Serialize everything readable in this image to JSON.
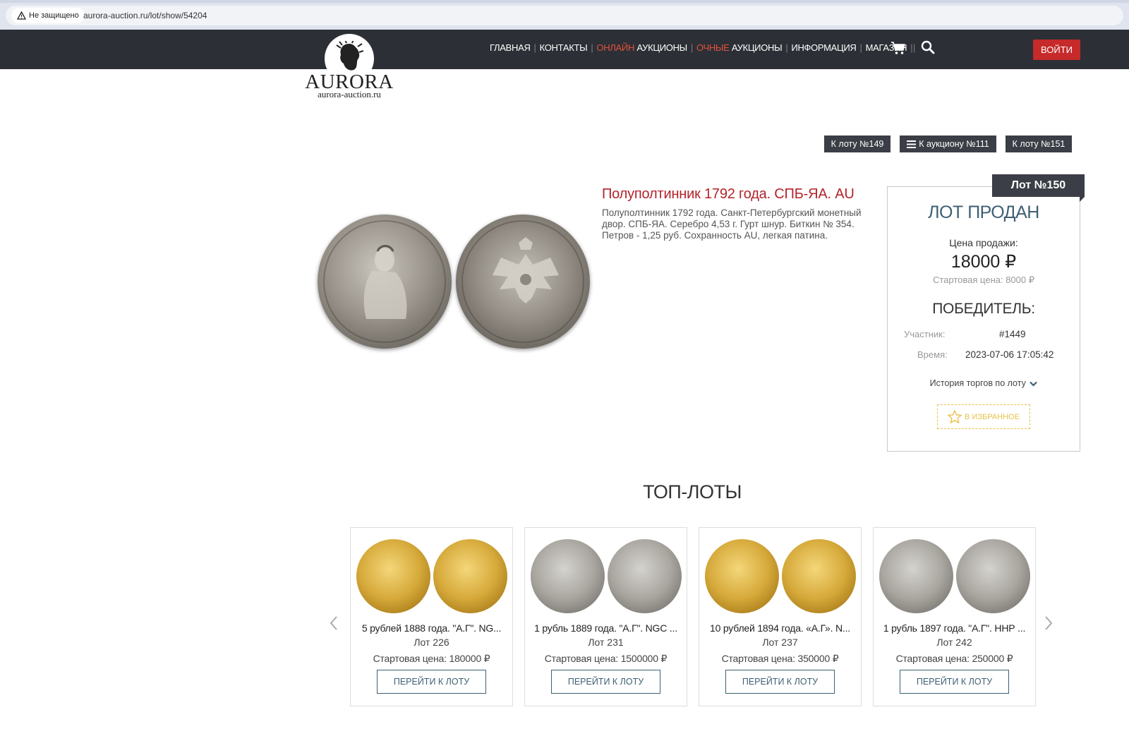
{
  "browser": {
    "security_label": "Не защищено",
    "url": "aurora-auction.ru/lot/show/54204"
  },
  "header": {
    "nav": {
      "home": "ГЛАВНАЯ",
      "contacts": "КОНТАКТЫ",
      "online_accent": "ОНЛАЙН",
      "online_rest": " АУКЦИОНЫ",
      "offline_accent": "ОЧНЫЕ",
      "offline_rest": " АУКЦИОНЫ",
      "info": "ИНФОРМАЦИЯ",
      "shop": "МАГАЗИН"
    },
    "login": "ВОЙТИ",
    "icons": [
      "cart-icon",
      "search-icon"
    ]
  },
  "logo": {
    "name": "AURORA",
    "domain": "aurora-auction.ru"
  },
  "lot_nav": {
    "prev": "К лоту №149",
    "auction": "К аукциону №111",
    "next": "К лоту №151"
  },
  "lot": {
    "title": "Полуполтинник 1792 года. СПБ-ЯА. AU",
    "description": "Полуполтинник 1792 года. Санкт-Петербургский монетный двор. СПБ-ЯА. Серебро 4,53 г. Гурт шнур. Биткин № 354. Петров - 1,25 руб. Сохранность AU, легкая патина."
  },
  "sold_panel": {
    "badge": "Лот №150",
    "status": "ЛОТ ПРОДАН",
    "price_label": "Цена продажи:",
    "price": "18000 ₽",
    "start_price": "Стартовая цена: 8000 ₽",
    "winner_title": "ПОБЕДИТЕЛЬ:",
    "participant_label": "Участник:",
    "participant_value": "#1449",
    "time_label": "Время:",
    "time_value": "2023-07-06 17:05:42",
    "history": "История торгов по лоту",
    "favorite": "В ИЗБРАННОЕ"
  },
  "top_lots": {
    "title": "ТОП-ЛОТЫ",
    "items": [
      {
        "title": "5 рублей 1888 года. \"А.Г\". NG...",
        "lot": "Лот 226",
        "price": "Стартовая цена: 180000 ₽",
        "button": "ПЕРЕЙТИ К ЛОТУ",
        "metal": "gold"
      },
      {
        "title": "1 рубль 1889 года. \"А.Г\". NGC ...",
        "lot": "Лот 231",
        "price": "Стартовая цена: 1500000 ₽",
        "button": "ПЕРЕЙТИ К ЛОТУ",
        "metal": "silver"
      },
      {
        "title": "10 рублей 1894 года. «А.Г». N...",
        "lot": "Лот 237",
        "price": "Стартовая цена: 350000 ₽",
        "button": "ПЕРЕЙТИ К ЛОТУ",
        "metal": "gold"
      },
      {
        "title": "1 рубль 1897 года. \"А.Г\". ННР ...",
        "lot": "Лот 242",
        "price": "Стартовая цена: 250000 ₽",
        "button": "ПЕРЕЙТИ К ЛОТУ",
        "metal": "silver"
      }
    ]
  },
  "colors": {
    "header_bg": "#2c2f36",
    "accent_red": "#c62a2a",
    "nav_accent": "#e0523c",
    "title_red": "#b3242a",
    "panel_blue": "#3e5f73",
    "favorite_yellow": "#e8c24b"
  }
}
